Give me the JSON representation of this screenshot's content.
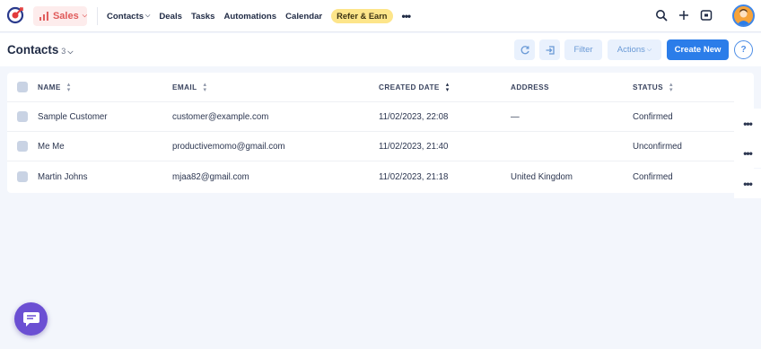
{
  "topbar": {
    "module_label": "Sales",
    "nav_items": [
      {
        "label": "Contacts",
        "has_dropdown": true
      },
      {
        "label": "Deals",
        "has_dropdown": false
      },
      {
        "label": "Tasks",
        "has_dropdown": false
      },
      {
        "label": "Automations",
        "has_dropdown": false
      },
      {
        "label": "Calendar",
        "has_dropdown": false
      }
    ],
    "refer_label": "Refer & Earn",
    "more_label": "•••",
    "icons": [
      "search-icon",
      "plus-icon",
      "apps-icon",
      "user-avatar"
    ]
  },
  "subheader": {
    "title": "Contacts",
    "count": "3",
    "filter_label": "Filter",
    "actions_label": "Actions",
    "create_label": "Create New",
    "help_label": "?"
  },
  "table": {
    "columns": {
      "name": "NAME",
      "email": "EMAIL",
      "created": "CREATED DATE",
      "address": "ADDRESS",
      "status": "STATUS"
    },
    "rows": [
      {
        "name": "Sample Customer",
        "email": "customer@example.com",
        "created": "11/02/2023, 22:08",
        "address": "—",
        "status": "Confirmed"
      },
      {
        "name": "Me Me",
        "email": "productivemomo@gmail.com",
        "created": "11/02/2023, 21:40",
        "address": "",
        "status": "Unconfirmed"
      },
      {
        "name": "Martin Johns",
        "email": "mjaa82@gmail.com",
        "created": "11/02/2023, 21:18",
        "address": "United Kingdom",
        "status": "Confirmed"
      }
    ],
    "row_menu_label": "•••"
  },
  "colors": {
    "accent": "#2b7de9",
    "sales": "#e05a5a",
    "refer_bg": "#fde58a",
    "chat": "#6b4fd3"
  }
}
